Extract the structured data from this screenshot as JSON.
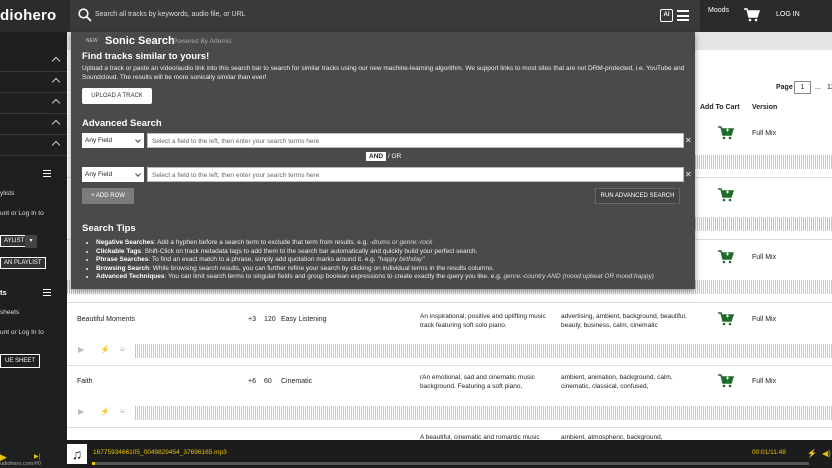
{
  "header": {
    "brand": "diohero",
    "search_placeholder": "Search all tracks by keywords, audio file, or URL",
    "ai_label": "AI",
    "moods": "Moods",
    "login": "LOG IN"
  },
  "sidebar": {
    "my_playlists": "ylists",
    "account_text": "unt or Log In to",
    "playlist_btn": "AYLIST",
    "playlist_caret": "▾",
    "new_playlist_btn": "AN PLAYLIST",
    "cue_title": "ts",
    "cue_sheets": "sheets",
    "cue_account": "unt or Log In to",
    "cue_btn": "UE SHEET",
    "url": "udiohero.com/#0"
  },
  "overlay": {
    "new": "NEW",
    "title": "Sonic Search",
    "powered": "Powered By Artemis",
    "find_heading": "Find tracks similar to yours!",
    "find_text": "Upload a track or paste an video/audio link into this search bar to search for similar tracks using our new machine-learning algorithm. We support links to most sites that are not DRM-protected, i.e. YouTube and Soundcloud. The results will be more sonically similar than ever!",
    "upload_btn": "UPLOAD A TRACK",
    "adv_heading": "Advanced Search",
    "field_select": "Any Field",
    "field_placeholder": "Select a field to the left, then enter your search terms here",
    "and_label": "AND",
    "or_label": "/ OR",
    "add_row": "+ ADD ROW",
    "run_btn": "RUN ADVANCED SEARCH",
    "tips_heading": "Search Tips",
    "tips": [
      {
        "label": "Negative Searches",
        "text": ": Add a hyphen before a search term to exclude that term from results. e.g. ",
        "example": "-drums or genre:-rock"
      },
      {
        "label": "Clickable Tags",
        "text": ": Shift-Click on track metadata tags to add them to the search bar automatically and quickly build your perfect search.",
        "example": ""
      },
      {
        "label": "Phrase Searches",
        "text": ": To find an exact match to a phrase, simply add quotation marks around it. e.g. ",
        "example": "\"happy birthday\""
      },
      {
        "label": "Browsing Search",
        "text": ": While browsing search results, you can further refine your search by clicking on individual terms in the results columns.",
        "example": ""
      },
      {
        "label": "Advanced Techniques",
        "text": ": You can limit search terms to singular fields and group boolean expressions to create exactly the query you like. e.g. ",
        "example": "genre:-country AND (mood:upbeat OR mood:happy)"
      }
    ]
  },
  "results": {
    "page_label": "Page",
    "page_value": "1",
    "page_dots": "...",
    "page_last": "12",
    "col_add_to_cart": "Add To Cart",
    "col_version": "Version",
    "rows": [
      {
        "title": "",
        "versions": "",
        "bpm": "",
        "genre": "",
        "desc": "",
        "tags": "",
        "version": "Full Mix"
      },
      {
        "title": "",
        "versions": "",
        "bpm": "",
        "genre": "",
        "desc": "",
        "tags": "",
        "version": ""
      },
      {
        "title": "",
        "versions": "",
        "bpm": "",
        "genre": "",
        "desc": "",
        "tags": "",
        "version": "Full Mix"
      },
      {
        "title": "Beautiful Moments",
        "versions": "+3",
        "bpm": "120",
        "genre": "Easy Listening",
        "desc": "An inspirational, positive and uplifting music track featuring soft solo piano.",
        "tags": "advertising, ambient, background, beautiful, beauty, business, calm, cinematic",
        "version": "Full Mix"
      },
      {
        "title": "Faith",
        "versions": "+6",
        "bpm": "60",
        "genre": "Cinematic",
        "desc": "rAn emotional, sad and cinematic music background. Featuring a soft piano,",
        "tags": "ambient, animation, background, calm, cinematic, classical, confused,",
        "version": "Full Mix"
      },
      {
        "title": "",
        "versions": "",
        "bpm": "",
        "genre": "",
        "desc": "A beautiful, cinematic and romantic music",
        "tags": "ambient, atmospheric, background,",
        "version": ""
      }
    ]
  },
  "player": {
    "file": "1677593466105_0049829454_37696165.mp3",
    "time": "00:01/11:48",
    "progress": 0.002
  }
}
